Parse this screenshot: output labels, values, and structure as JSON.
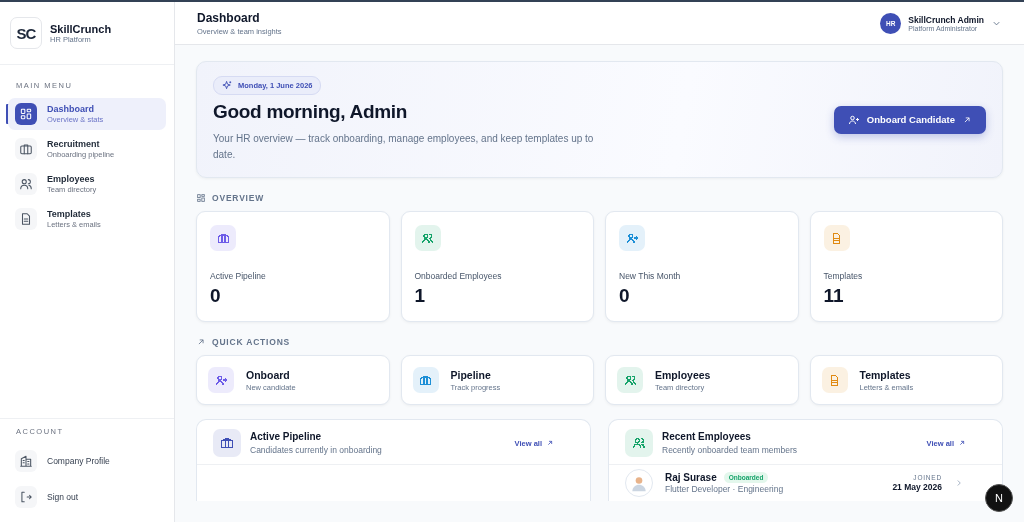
{
  "brand": {
    "logo": "SC",
    "name": "SkillCrunch",
    "subtitle": "HR Platform"
  },
  "sidebar": {
    "main_heading": "MAIN MENU",
    "items": [
      {
        "label": "Dashboard",
        "sub": "Overview & stats",
        "selected": true
      },
      {
        "label": "Recruitment",
        "sub": "Onboarding pipeline",
        "selected": false
      },
      {
        "label": "Employees",
        "sub": "Team directory",
        "selected": false
      },
      {
        "label": "Templates",
        "sub": "Letters & emails",
        "selected": false
      }
    ],
    "account_heading": "ACCOUNT",
    "account_items": [
      {
        "label": "Company Profile"
      },
      {
        "label": "Sign out"
      }
    ]
  },
  "header": {
    "title": "Dashboard",
    "subtitle": "Overview & team insights",
    "user": {
      "initials": "HR",
      "name": "SkillCrunch Admin",
      "role": "Platform Administrator"
    }
  },
  "hero": {
    "date": "Monday, 1 June 2026",
    "greeting": "Good morning, Admin",
    "text": "Your HR overview — track onboarding, manage employees, and keep templates up to date.",
    "button": "Onboard Candidate"
  },
  "overview": {
    "heading": "OVERVIEW",
    "stats": [
      {
        "label": "Active Pipeline",
        "value": "0",
        "color": "#6d5ce8"
      },
      {
        "label": "Onboarded Employees",
        "value": "1",
        "color": "#16a36a"
      },
      {
        "label": "New This Month",
        "value": "0",
        "color": "#1d8fd6"
      },
      {
        "label": "Templates",
        "value": "11",
        "color": "#e08a12"
      }
    ]
  },
  "quick_actions": {
    "heading": "QUICK ACTIONS",
    "items": [
      {
        "title": "Onboard",
        "sub": "New candidate",
        "color": "#6d5ce8"
      },
      {
        "title": "Pipeline",
        "sub": "Track progress",
        "color": "#1d8fd6"
      },
      {
        "title": "Employees",
        "sub": "Team directory",
        "color": "#16a36a"
      },
      {
        "title": "Templates",
        "sub": "Letters & emails",
        "color": "#e08a12"
      }
    ]
  },
  "panels": [
    {
      "title": "Active Pipeline",
      "sub": "Candidates currently in onboarding",
      "link": "View all",
      "color": "#3f4fb5"
    },
    {
      "title": "Recent Employees",
      "sub": "Recently onboarded team members",
      "link": "View all",
      "color": "#16a36a",
      "rows": [
        {
          "name": "Raj Surase",
          "badge": "Onboarded",
          "role": "Flutter Developer · Engineering",
          "joined_label": "JOINED",
          "joined": "21 May 2026"
        }
      ]
    }
  ],
  "dev_badge": "N"
}
